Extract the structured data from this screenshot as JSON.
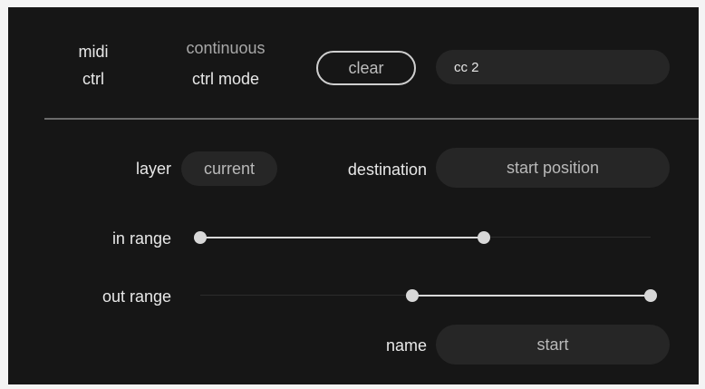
{
  "header": {
    "midi_ctrl": [
      "midi",
      "ctrl"
    ],
    "continuous_ctrl_mode": [
      "continuous",
      "ctrl mode"
    ],
    "clear_label": "clear",
    "cc_value": "cc 2"
  },
  "fields": {
    "layer_label": "layer",
    "layer_value": "current",
    "destination_label": "destination",
    "destination_value": "start position",
    "in_range_label": "in range",
    "out_range_label": "out range",
    "name_label": "name",
    "name_value": "start"
  },
  "sliders": {
    "in_range": {
      "min": 0.0,
      "max": 0.63
    },
    "out_range": {
      "min": 0.47,
      "max": 1.0
    }
  },
  "colors": {
    "panel_bg": "#161616",
    "pill_bg": "#262626",
    "text": "#e8e8e8",
    "muted_text": "#a8a8a8",
    "knob": "#d8d8d8"
  }
}
